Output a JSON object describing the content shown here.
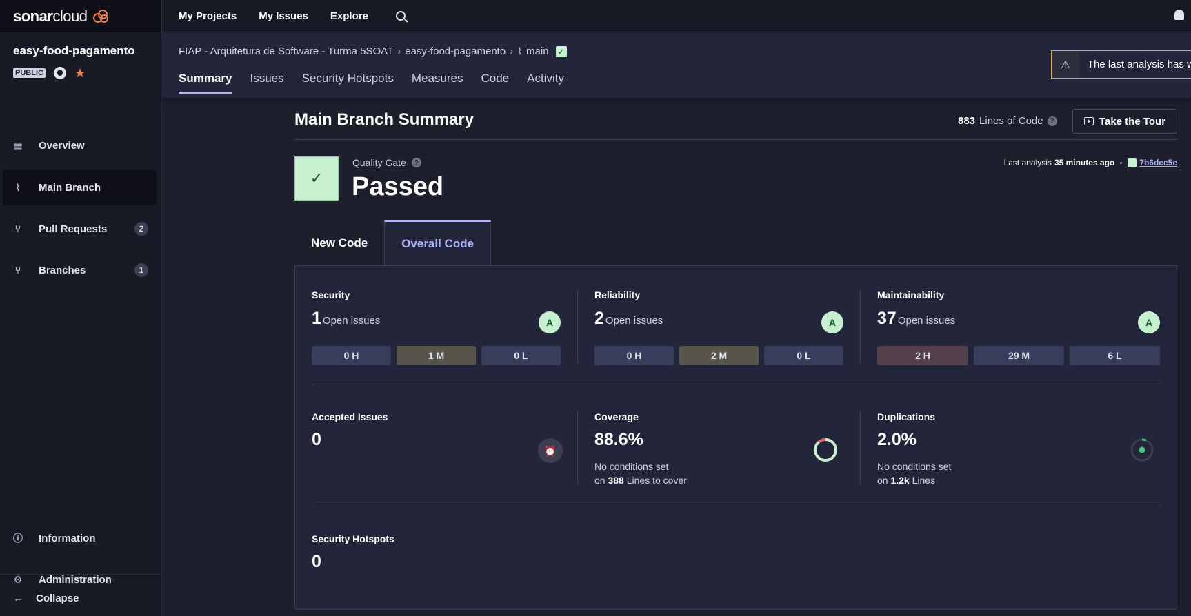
{
  "sidebar": {
    "logo_bold": "sonar",
    "logo_light": "cloud",
    "project_name": "easy-food-pagamento",
    "visibility": "PUBLIC",
    "items": [
      {
        "label": "Overview"
      },
      {
        "label": "Main Branch"
      },
      {
        "label": "Pull Requests",
        "count": "2"
      },
      {
        "label": "Branches",
        "count": "1"
      },
      {
        "label": "Information"
      },
      {
        "label": "Administration"
      },
      {
        "label": "Collapse"
      }
    ]
  },
  "topbar": {
    "links": [
      "My Projects",
      "My Issues",
      "Explore"
    ]
  },
  "header": {
    "breadcrumbs": [
      "FIAP - Arquitetura de Software - Turma 5SOAT",
      "easy-food-pagamento",
      "main"
    ],
    "tabs": [
      "Summary",
      "Issues",
      "Security Hotspots",
      "Measures",
      "Code",
      "Activity"
    ],
    "warning": "The last analysis has w"
  },
  "summary": {
    "title": "Main Branch Summary",
    "loc_value": "883",
    "loc_label": "Lines of Code",
    "tour_label": "Take the Tour",
    "quality_gate_label": "Quality Gate",
    "quality_gate_status": "Passed",
    "last_analysis_prefix": "Last analysis",
    "last_analysis_time": "35 minutes ago",
    "commit": "7b6dcc5e",
    "code_tabs": [
      "New Code",
      "Overall Code"
    ],
    "security": {
      "title": "Security",
      "value": "1",
      "label": "Open issues",
      "grade": "A",
      "h": "0 H",
      "m": "1 M",
      "l": "0 L"
    },
    "reliability": {
      "title": "Reliability",
      "value": "2",
      "label": "Open issues",
      "grade": "A",
      "h": "0 H",
      "m": "2 M",
      "l": "0 L"
    },
    "maintainability": {
      "title": "Maintainability",
      "value": "37",
      "label": "Open issues",
      "grade": "A",
      "h": "2 H",
      "m": "29 M",
      "l": "6 L"
    },
    "accepted": {
      "title": "Accepted Issues",
      "value": "0"
    },
    "coverage": {
      "title": "Coverage",
      "value": "88.6%",
      "note1": "No conditions set",
      "note_prefix": "on",
      "note_num": "388",
      "note_suffix": "Lines to cover"
    },
    "duplications": {
      "title": "Duplications",
      "value": "2.0%",
      "note1": "No conditions set",
      "note_prefix": "on",
      "note_num": "1.2k",
      "note_suffix": "Lines"
    },
    "hotspots": {
      "title": "Security Hotspots",
      "value": "0"
    }
  },
  "colors": {
    "accent": "#a9b3f5",
    "passed": "#c7f0d1",
    "brand_orange": "#ee7d4b"
  }
}
